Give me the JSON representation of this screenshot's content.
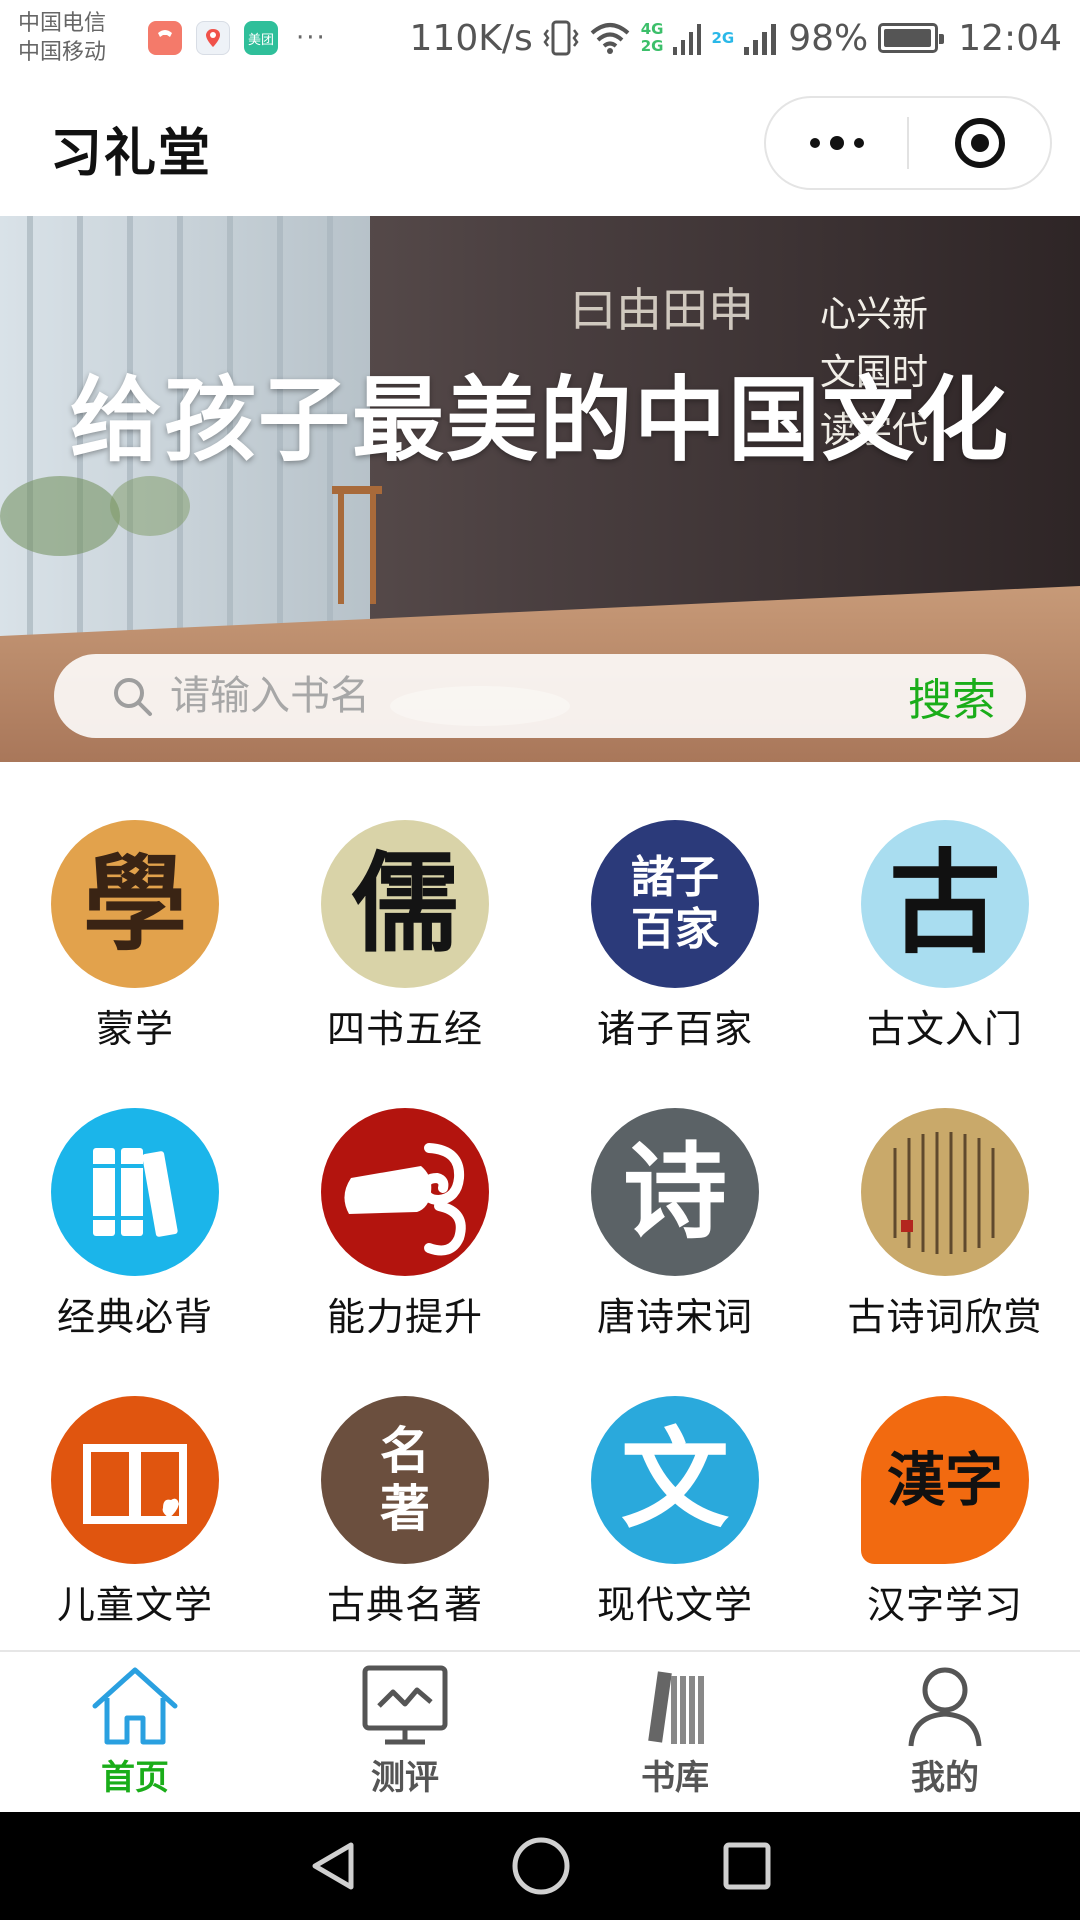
{
  "status_bar": {
    "carrier_1": "中国电信",
    "carrier_2": "中国移动",
    "notification_apps": [
      "phone-call-app-icon",
      "map-location-app-icon",
      "meituan-app-icon"
    ],
    "notification_app_meituan_label": "美团",
    "overflow": "···",
    "net_speed": "110K/s",
    "net_type_top": "4G",
    "net_type_bottom": "2G",
    "net_type_2": "2G",
    "battery_percent": "98%",
    "battery_level": 0.98,
    "time": "12:04"
  },
  "title_bar": {
    "title": "习礼堂"
  },
  "banner": {
    "slogan": "给孩子最美的中国文化",
    "wall_chars_left": "曰由田申",
    "wall_chars_right": [
      "心兴新",
      "文国时",
      "读学代"
    ]
  },
  "search": {
    "placeholder": "请输入书名",
    "value": "",
    "button_label": "搜索"
  },
  "categories": [
    {
      "label": "蒙学",
      "icon_glyph": "學",
      "color": "#e2a24c"
    },
    {
      "label": "四书五经",
      "icon_glyph": "儒",
      "color": "#d9d3a8"
    },
    {
      "label": "诸子百家",
      "icon_glyph": "諸子百家",
      "color": "#2b3a7a"
    },
    {
      "label": "古文入门",
      "icon_glyph": "古",
      "color": "#a9ddf0"
    },
    {
      "label": "经典必背",
      "icon_glyph": "",
      "color": "#1bb5ea"
    },
    {
      "label": "能力提升",
      "icon_glyph": "",
      "color": "#b3140e"
    },
    {
      "label": "唐诗宋词",
      "icon_glyph": "诗",
      "color": "#5b6266"
    },
    {
      "label": "古诗词欣赏",
      "icon_glyph": "",
      "color": "#c9a96a"
    },
    {
      "label": "儿童文学",
      "icon_glyph": "",
      "color": "#e0550f"
    },
    {
      "label": "古典名著",
      "icon_glyph": "名著",
      "color": "#6b4f3e"
    },
    {
      "label": "现代文学",
      "icon_glyph": "文",
      "color": "#2aa9dc"
    },
    {
      "label": "汉字学习",
      "icon_glyph": "漢字",
      "color": "#f26a10"
    }
  ],
  "tabs": [
    {
      "label": "首页",
      "active": true
    },
    {
      "label": "测评",
      "active": false
    },
    {
      "label": "书库",
      "active": false
    },
    {
      "label": "我的",
      "active": false
    }
  ],
  "colors": {
    "accent_green": "#1aad19",
    "tab_inactive": "#555555",
    "home_icon_blue": "#2aa0e0"
  }
}
